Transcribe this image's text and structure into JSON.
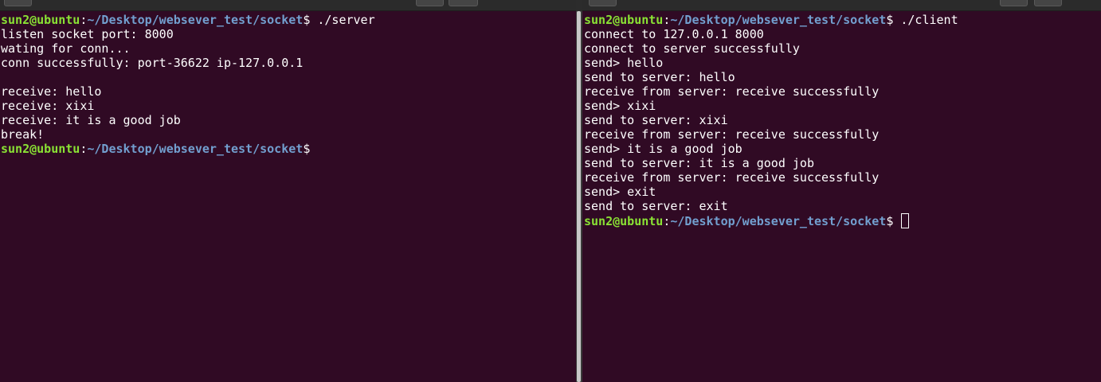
{
  "prompt": {
    "user_host": "sun2@ubuntu",
    "colon": ":",
    "path": "~/Desktop/websever_test/socket",
    "symbol": "$"
  },
  "left_terminal": {
    "command": " ./server",
    "output": [
      "listen socket port: 8000",
      "wating for conn...",
      "conn successfully: port-36622 ip-127.0.0.1",
      "",
      "receive: hello",
      "receive: xixi",
      "receive: it is a good job",
      "break!"
    ]
  },
  "right_terminal": {
    "command": " ./client",
    "output": [
      "connect to 127.0.0.1 8000",
      "connect to server successfully",
      "send> hello",
      "send to server: hello",
      "receive from server: receive successfully",
      "send> xixi",
      "send to server: xixi",
      "receive from server: receive successfully",
      "send> it is a good job",
      "send to server: it is a good job",
      "receive from server: receive successfully",
      "send> exit",
      "send to server: exit"
    ]
  },
  "colors": {
    "terminal_background": "#300a24",
    "prompt_user": "#8ae234",
    "prompt_path": "#729fcf",
    "text": "#ffffff"
  }
}
